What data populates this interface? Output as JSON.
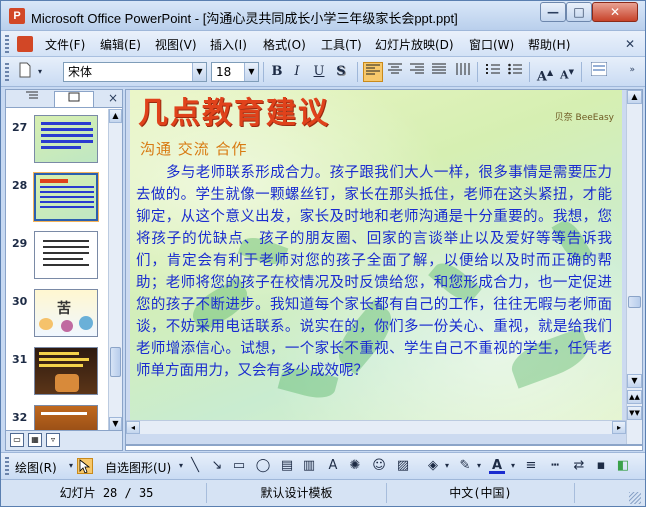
{
  "window": {
    "app_icon": "P",
    "title": "Microsoft Office PowerPoint - [沟通心灵共同成长小学三年级家长会ppt.ppt]",
    "minimize": "—",
    "maximize": "□",
    "close": "✕"
  },
  "menu": {
    "items": [
      "文件(F)",
      "编辑(E)",
      "视图(V)",
      "插入(I)",
      "格式(O)",
      "工具(T)",
      "幻灯片放映(D)",
      "窗口(W)",
      "帮助(H)"
    ],
    "doc_close": "✕"
  },
  "toolbar": {
    "font_name": "宋体",
    "font_size": "18",
    "bold": "B",
    "italic": "I",
    "underline": "U",
    "shadow": "S",
    "grow_font": "A",
    "shrink_font": "A",
    "active_align": "align-left"
  },
  "left_panel": {
    "tab_outline_icon": "outline-icon",
    "tab_slides_icon": "slides-icon",
    "close": "×",
    "thumbnails": [
      {
        "number": "27",
        "label": "",
        "selected": false
      },
      {
        "number": "28",
        "label": "",
        "selected": true
      },
      {
        "number": "29",
        "label": "",
        "selected": false
      },
      {
        "number": "30",
        "label": "苦",
        "selected": false
      },
      {
        "number": "31",
        "label": "",
        "selected": false
      },
      {
        "number": "32",
        "label": "",
        "selected": false
      }
    ]
  },
  "slide": {
    "title": "几点教育建议",
    "logo": "贝奈 BeeEasy",
    "subtitle": "沟通 交流 合作",
    "body": "多与老师联系形成合力。孩子跟我们大人一样，很多事情是需要压力去做的。学生就像一颗螺丝钉，家长在那头抵住，老师在这头紧扭，才能铆定，从这个意义出发，家长及时地和老师沟通是十分重要的。我想，您将孩子的优缺点、孩子的朋友圈、回家的言谈举止以及爱好等等告诉我们，肯定会有利于老师对您的孩子全面了解，以便给以及时而正确的帮助；老师将您的孩子在校情况及时反馈给您，和您形成合力，也一定促进您的孩子不断进步。我知道每个家长都有自己的工作，往往无暇与老师面谈，不妨采用电话联系。说实在的，你们多一份关心、重视，就是给我们老师增添信心。试想，一个家长不重视、学生自己不重视的学生，任凭老师单方面用力，又会有多少成效呢？"
  },
  "drawing_toolbar": {
    "draw_menu": "绘图(R)",
    "autoshapes_menu": "自选图形(U)"
  },
  "status": {
    "slide_position": "幻灯片 28 / 35",
    "design_template": "默认设计模板",
    "language": "中文(中国)"
  }
}
